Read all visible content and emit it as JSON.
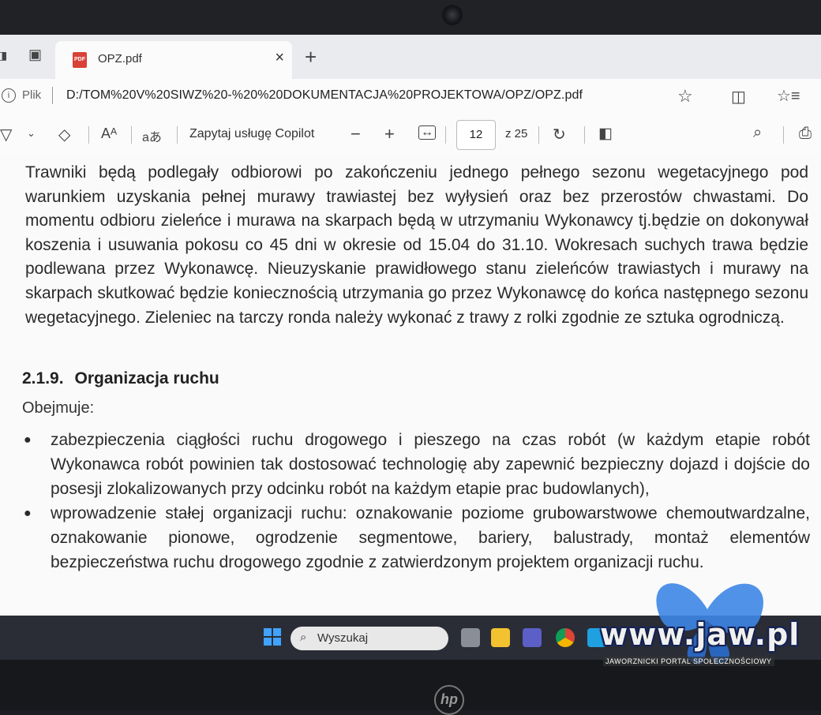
{
  "browser": {
    "tab_title": "OPZ.pdf",
    "tab_icon_label": "PDF",
    "address_label": "Plik",
    "url": "D:/TOM%20V%20SIWZ%20-%20%20DOKUMENTACJA%20PROJEKTOWA/OPZ/OPZ.pdf"
  },
  "pdf_toolbar": {
    "ask_copilot": "Zapytaj usługę Copilot",
    "current_page": "12",
    "total_pages": "z 25"
  },
  "document": {
    "paragraph": "Trawniki będą podlegały odbiorowi po zakończeniu jednego pełnego sezonu wegetacyjnego pod warunkiem uzyskania pełnej murawy trawiastej bez wyłysień oraz bez przerostów chwastami. Do momentu odbioru zieleńce i murawa na skarpach będą w utrzymaniu Wykonawcy tj.będzie on dokonywał koszenia i usuwania pokosu co 45 dni w okresie od 15.04 do 31.10. Wokresach suchych trawa będzie podlewana przez Wykonawcę. Nieuzyskanie prawidłowego stanu zieleńców trawiastych i murawy na skarpach skutkować będzie koniecznością utrzymania go przez Wykonawcę do końca następnego sezonu wegetacyjnego. Zieleniec na tarczy ronda należy wykonać z trawy z rolki zgodnie ze sztuka ogrodniczą.",
    "heading_number": "2.1.9.",
    "heading_title": "Organizacja ruchu",
    "intro": "Obejmuje:",
    "bullets": [
      "zabezpieczenia ciągłości ruchu drogowego i pieszego na czas robót (w każdym etapie robót Wykonawca robót powinien tak dostosować technologię aby zapewnić bezpieczny dojazd i dojście do posesji zlokalizowanych przy odcinku robót na każdym etapie prac budowlanych),",
      "wprowadzenie stałej organizacji ruchu: oznakowanie poziome grubowarstwowe chemoutwardzalne, oznakowanie pionowe, ogrodzenie segmentowe, bariery, balustrady, montaż elementów bezpieczeństwa ruchu drogowego zgodnie z zatwierdzonym projektem organizacji ruchu."
    ]
  },
  "taskbar": {
    "search_label": "Wyszukaj"
  },
  "watermark": {
    "text": "www.jaw.pl",
    "subtitle": "JAWORZNICKI PORTAL SPOŁECZNOŚCIOWY"
  },
  "laptop": {
    "brand": "hp"
  }
}
